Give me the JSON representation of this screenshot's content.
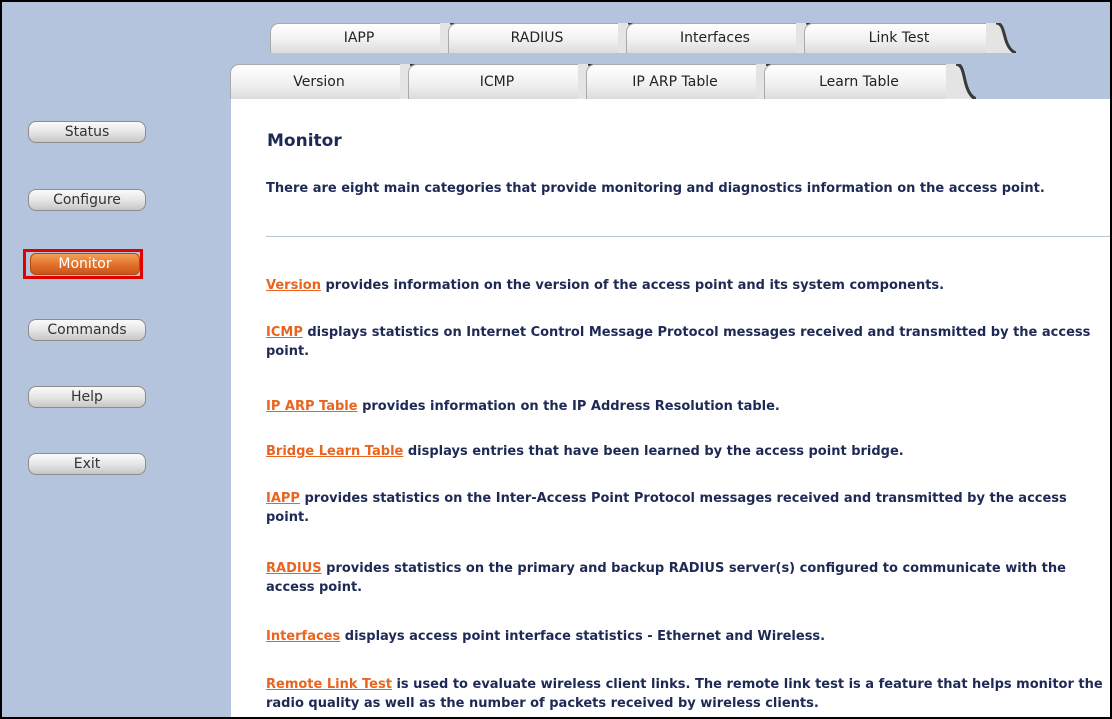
{
  "tabs_top": [
    "IAPP",
    "RADIUS",
    "Interfaces",
    "Link Test"
  ],
  "tabs_bottom": [
    "Version",
    "ICMP",
    "IP ARP Table",
    "Learn Table"
  ],
  "nav": {
    "status": "Status",
    "configure": "Configure",
    "monitor": "Monitor",
    "commands": "Commands",
    "help": "Help",
    "exit": "Exit"
  },
  "colors": {
    "active_nav": "#e0712a",
    "highlight_box": "#e00000",
    "link": "#e8641f",
    "text": "#1e2a55",
    "sidebar_bg": "#b4c4dd"
  },
  "content": {
    "title": "Monitor",
    "intro": "There are eight main categories that provide monitoring and diagnostics information on the access point.",
    "items": [
      {
        "link": "Version",
        "text": " provides information on the version of the access point and its system components."
      },
      {
        "link": "ICMP",
        "text": " displays statistics on Internet Control Message Protocol messages received and transmitted by the access point."
      },
      {
        "link": "IP ARP Table",
        "text": " provides information on the IP Address Resolution table."
      },
      {
        "link": "Bridge Learn Table",
        "text": " displays entries that have been learned by the access point bridge."
      },
      {
        "link": "IAPP",
        "text": " provides statistics on the Inter-Access Point Protocol messages received and transmitted by the access point."
      },
      {
        "link": "RADIUS",
        "text": " provides statistics on the primary and backup RADIUS server(s) configured to communicate with the access point."
      },
      {
        "link": "Interfaces",
        "text": " displays access point interface statistics - Ethernet and Wireless."
      },
      {
        "link": "Remote Link Test",
        "text": " is used to evaluate wireless client links. The remote link test is a feature that helps monitor the radio quality as well as the number of packets received by wireless clients."
      }
    ]
  }
}
